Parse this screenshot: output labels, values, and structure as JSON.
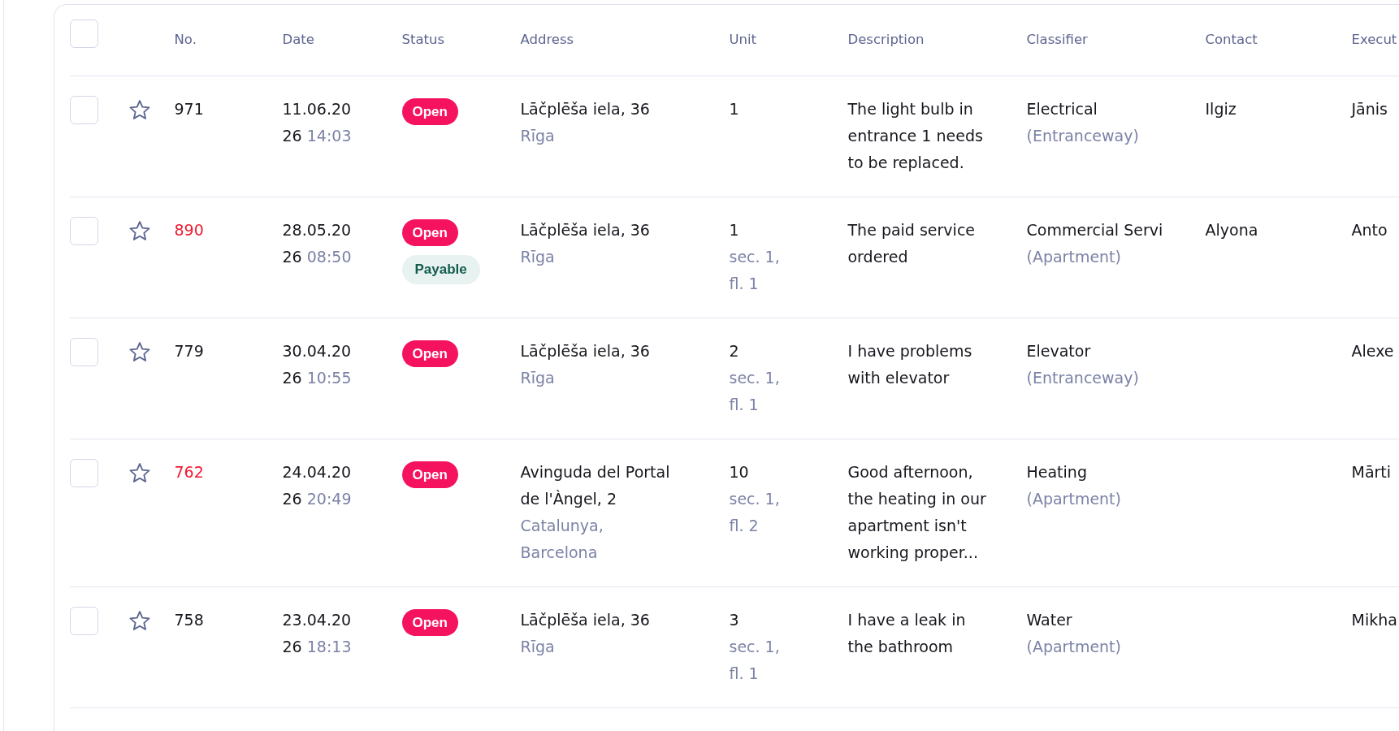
{
  "table": {
    "select_all": {
      "checked": false
    },
    "columns": [
      "No.",
      "Date",
      "Status",
      "Address",
      "Unit",
      "Description",
      "Classifier",
      "Contact",
      "Execut"
    ],
    "rows": [
      {
        "checked": false,
        "starred": false,
        "number": {
          "text": "971",
          "color": "#16161d"
        },
        "date": "11.06.2026",
        "time": "14:03",
        "statuses": [
          {
            "kind": "open",
            "label": "Open"
          }
        ],
        "address": "Lāčplēša iela, 36",
        "city": "Rīga",
        "unit": "1",
        "description": "The light bulb in entrance 1 needs to be replaced.",
        "classifier": "Electrical",
        "classifier_area": "(Entranceway)",
        "contact": "Ilgiz",
        "executor": "Jānis"
      },
      {
        "checked": false,
        "starred": false,
        "number": {
          "text": "890",
          "color": "#f0192f"
        },
        "date": "28.05.2026",
        "time": "08:50",
        "statuses": [
          {
            "kind": "open",
            "label": "Open"
          },
          {
            "kind": "payable",
            "label": "Payable"
          }
        ],
        "address": "Lāčplēša iela, 36",
        "city": "Rīga",
        "unit": "1",
        "unit_location": "sec. 1, fl. 1",
        "description": "The paid service ordered",
        "classifier": "Commercial Servi",
        "classifier_area": "(Apartment)",
        "contact": "Alyona",
        "executor": "Anto"
      },
      {
        "checked": false,
        "starred": false,
        "number": {
          "text": "779",
          "color": "#16161d"
        },
        "date": "30.04.2026",
        "time": "10:55",
        "statuses": [
          {
            "kind": "open",
            "label": "Open"
          }
        ],
        "address": "Lāčplēša iela, 36",
        "city": "Rīga",
        "unit": "2",
        "unit_location": "sec. 1, fl. 1",
        "description": "I have problems with elevator",
        "classifier": "Elevator",
        "classifier_area": "(Entranceway)",
        "executor": "Alexe"
      },
      {
        "checked": false,
        "starred": false,
        "number": {
          "text": "762",
          "color": "#f0192f"
        },
        "date": "24.04.2026",
        "time": "20:49",
        "statuses": [
          {
            "kind": "open",
            "label": "Open"
          }
        ],
        "address": "Avinguda del Portal de l'Àngel, 2",
        "city": "Catalunya, Barcelona",
        "unit": "10",
        "unit_location": "sec. 1, fl. 2",
        "description": "Good afternoon, the heating in our apartment isn't working proper...",
        "classifier": "Heating",
        "classifier_area": "(Apartment)",
        "executor": "Mārti"
      },
      {
        "checked": false,
        "starred": false,
        "number": {
          "text": "758",
          "color": "#16161d"
        },
        "date": "23.04.2026",
        "time": "18:13",
        "statuses": [
          {
            "kind": "open",
            "label": "Open"
          }
        ],
        "address": "Lāčplēša iela, 36",
        "city": "Rīga",
        "unit": "3",
        "unit_location": "sec. 1, fl. 1",
        "description": "I have a leak in the bathroom",
        "classifier": "Water",
        "classifier_area": "(Apartment)",
        "executor": "Mikha"
      }
    ]
  }
}
